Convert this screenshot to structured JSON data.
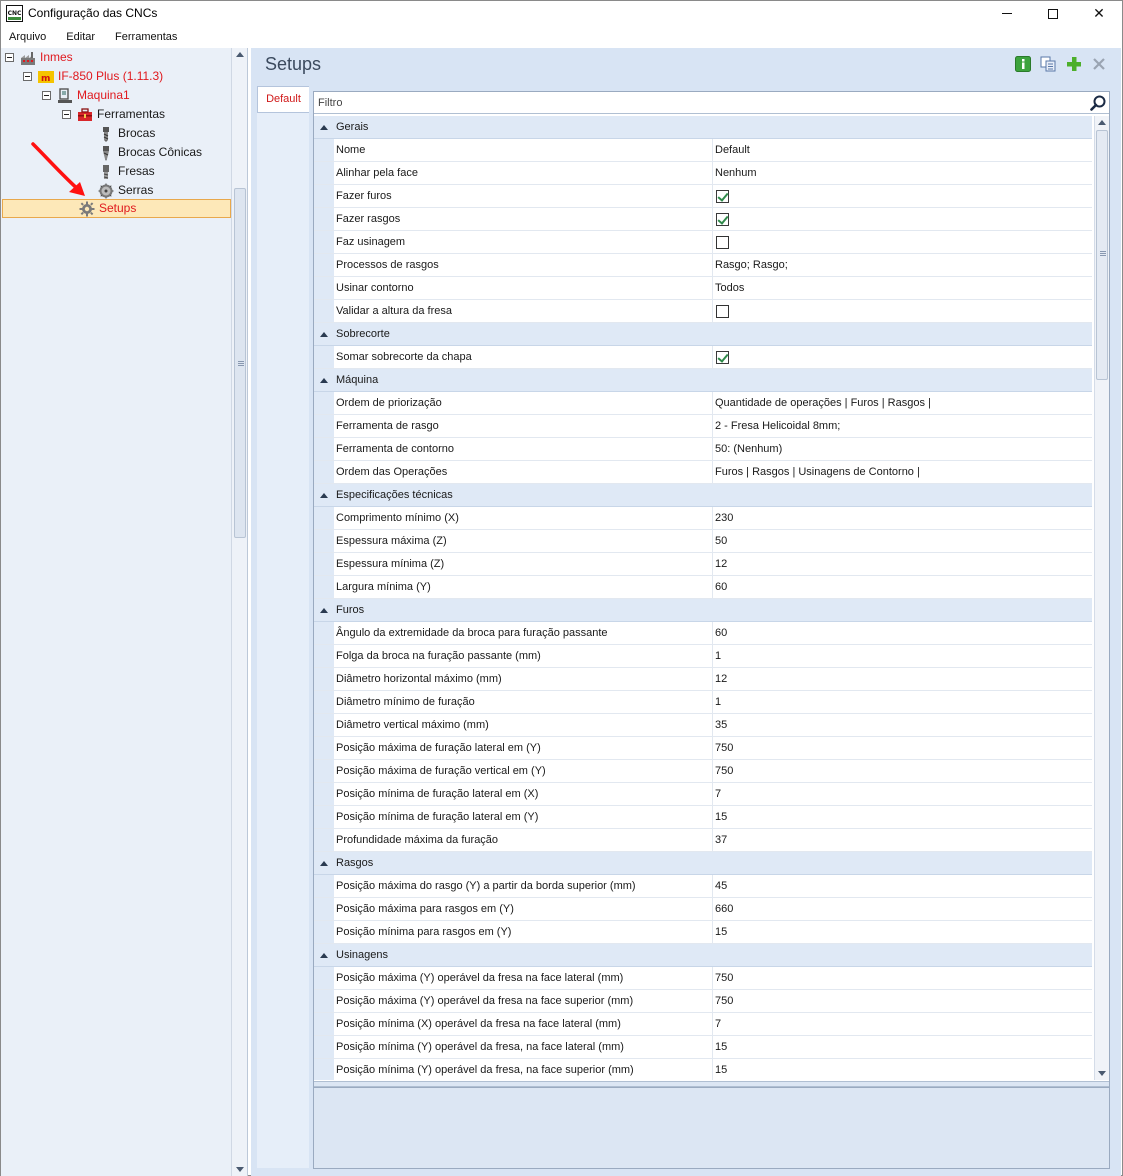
{
  "window": {
    "title": "Configuração das CNCs",
    "app_icon_text": "CNC",
    "controls": {
      "minimize": "minimize-icon",
      "maximize": "maximize-icon",
      "close": "✕"
    }
  },
  "menu": [
    "Arquivo",
    "Editar",
    "Ferramentas"
  ],
  "tree": {
    "items": [
      {
        "label": "Inmes",
        "icon": "factory-icon",
        "color": "#e0191e"
      },
      {
        "label": "IF-850 Plus (1.11.3)",
        "icon": "machine-logo-icon",
        "color": "#e0191e"
      },
      {
        "label": "Maquina1",
        "icon": "cnc-machine-icon",
        "color": "#e0191e"
      },
      {
        "label": "Ferramentas",
        "icon": "toolbox-icon",
        "color": "#1a1a1a"
      },
      {
        "label": "Brocas",
        "icon": "drill-bit-icon",
        "color": "#1a1a1a"
      },
      {
        "label": "Brocas Cônicas",
        "icon": "conical-drill-icon",
        "color": "#1a1a1a"
      },
      {
        "label": "Fresas",
        "icon": "milling-cutter-icon",
        "color": "#1a1a1a"
      },
      {
        "label": "Serras",
        "icon": "saw-blade-icon",
        "color": "#1a1a1a"
      },
      {
        "label": "Setups",
        "icon": "gear-icon",
        "color": "#e0191e",
        "selected": true
      }
    ]
  },
  "content": {
    "title": "Setups",
    "toolbar": [
      "info-icon",
      "copy-icon",
      "add-icon",
      "delete-icon"
    ],
    "tab": "Default",
    "filter_placeholder": "Filtro",
    "categories": [
      {
        "name": "Gerais",
        "props": [
          {
            "name": "Nome",
            "value": "Default"
          },
          {
            "name": "Alinhar pela face",
            "value": "Nenhum"
          },
          {
            "name": "Fazer furos",
            "checked": true
          },
          {
            "name": "Fazer rasgos",
            "checked": true
          },
          {
            "name": "Faz usinagem",
            "checked": false
          },
          {
            "name": "Processos de rasgos",
            "value": "Rasgo; Rasgo;"
          },
          {
            "name": "Usinar contorno",
            "value": "Todos"
          },
          {
            "name": "Validar a altura da fresa",
            "checked": false
          }
        ]
      },
      {
        "name": "Sobrecorte",
        "props": [
          {
            "name": "Somar sobrecorte da chapa",
            "checked": true
          }
        ]
      },
      {
        "name": "Máquina",
        "props": [
          {
            "name": "Ordem de priorização",
            "value": "Quantidade de operações | Furos | Rasgos |"
          },
          {
            "name": "Ferramenta de rasgo",
            "value": "2 - Fresa Helicoidal 8mm;"
          },
          {
            "name": "Ferramenta de contorno",
            "value": "50: (Nenhum)"
          },
          {
            "name": "Ordem das Operações",
            "value": "Furos | Rasgos | Usinagens de Contorno |"
          }
        ]
      },
      {
        "name": "Especificações técnicas",
        "props": [
          {
            "name": "Comprimento mínimo (X)",
            "value": "230"
          },
          {
            "name": "Espessura máxima (Z)",
            "value": "50"
          },
          {
            "name": "Espessura mínima (Z)",
            "value": "12"
          },
          {
            "name": "Largura mínima (Y)",
            "value": "60"
          }
        ]
      },
      {
        "name": "Furos",
        "props": [
          {
            "name": "Ângulo da extremidade da broca para furação passante",
            "value": "60"
          },
          {
            "name": "Folga da broca na furação passante (mm)",
            "value": "1"
          },
          {
            "name": "Diâmetro horizontal máximo (mm)",
            "value": "12"
          },
          {
            "name": "Diâmetro mínimo de furação",
            "value": "1"
          },
          {
            "name": "Diâmetro vertical máximo (mm)",
            "value": "35"
          },
          {
            "name": "Posição máxima de furação lateral em (Y)",
            "value": "750"
          },
          {
            "name": "Posição máxima de furação vertical em (Y)",
            "value": "750"
          },
          {
            "name": "Posição mínima de furação lateral em (X)",
            "value": "7"
          },
          {
            "name": "Posição mínima de furação lateral em (Y)",
            "value": "15"
          },
          {
            "name": "Profundidade máxima da furação",
            "value": "37"
          }
        ]
      },
      {
        "name": "Rasgos",
        "props": [
          {
            "name": "Posição máxima do rasgo (Y) a partir da borda superior (mm)",
            "value": "45"
          },
          {
            "name": "Posição máxima para rasgos em (Y)",
            "value": "660"
          },
          {
            "name": "Posição mínima para rasgos em (Y)",
            "value": "15"
          }
        ]
      },
      {
        "name": "Usinagens",
        "props": [
          {
            "name": "Posição máxima (Y) operável da fresa na face lateral (mm)",
            "value": "750"
          },
          {
            "name": "Posição máxima (Y) operável da fresa na face superior (mm)",
            "value": "750"
          },
          {
            "name": "Posição mínima (X) operável da fresa na face lateral (mm)",
            "value": "7"
          },
          {
            "name": "Posição mínima (Y) operável da fresa, na face lateral (mm)",
            "value": "15"
          },
          {
            "name": "Posição mínima (Y) operável da fresa, na face superior (mm)",
            "value": "15"
          }
        ]
      }
    ]
  },
  "colors": {
    "accent_red": "#e0191e",
    "selection_bg": "#fde8b8",
    "panel_bg": "#d8e4f4",
    "check_green": "#2f8a4a"
  }
}
